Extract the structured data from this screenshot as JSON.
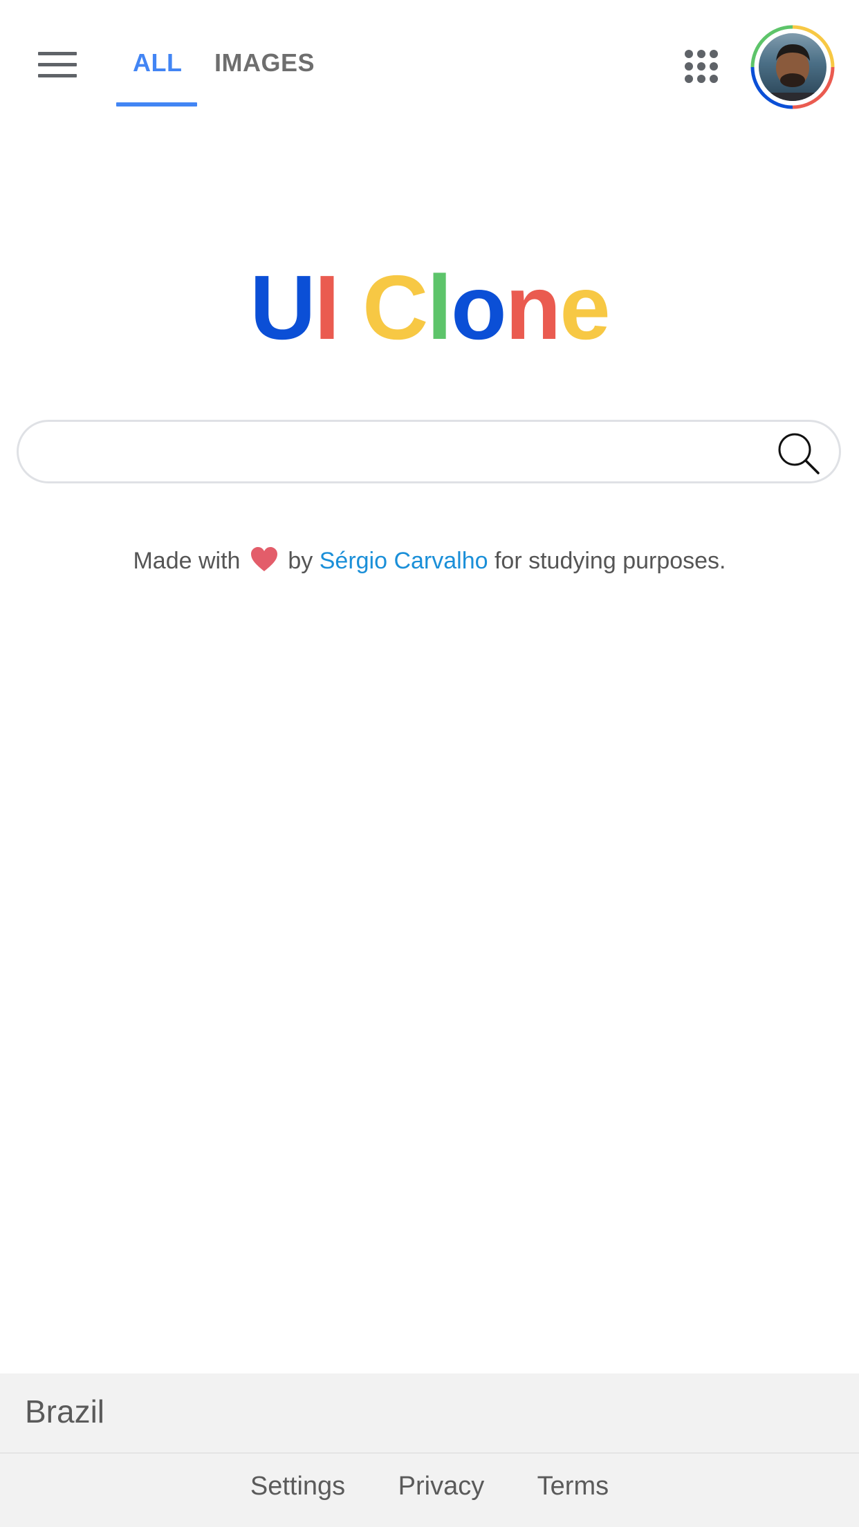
{
  "header": {
    "tabs": [
      {
        "label": "ALL",
        "active": true
      },
      {
        "label": "IMAGES",
        "active": false
      }
    ],
    "menu_icon": "hamburger-menu-icon",
    "apps_icon": "apps-grid-icon",
    "avatar_icon": "user-avatar"
  },
  "logo": {
    "letters": [
      {
        "char": "U",
        "color": "#0b4fd6"
      },
      {
        "char": "I",
        "color": "#ea5b50"
      },
      {
        "char": " ",
        "color": "#ffffff"
      },
      {
        "char": "C",
        "color": "#f7c844"
      },
      {
        "char": "l",
        "color": "#5dc46a"
      },
      {
        "char": "o",
        "color": "#0b4fd6"
      },
      {
        "char": "n",
        "color": "#ea5b50"
      },
      {
        "char": "e",
        "color": "#f7c844"
      }
    ]
  },
  "search": {
    "value": "",
    "placeholder": "",
    "icon": "search-icon"
  },
  "credit": {
    "prefix": "Made with",
    "by": "by",
    "author": "Sérgio Carvalho",
    "suffix": "for studying purposes.",
    "heart_color": "#e35d6a",
    "link_color": "#1a8fd8"
  },
  "footer": {
    "country": "Brazil",
    "links": [
      "Settings",
      "Privacy",
      "Terms"
    ]
  },
  "colors": {
    "accent": "#4285f4",
    "ring_green": "#5dc46a",
    "ring_yellow": "#f7c844",
    "ring_red": "#ea5b50",
    "ring_blue": "#0b4fd6"
  }
}
